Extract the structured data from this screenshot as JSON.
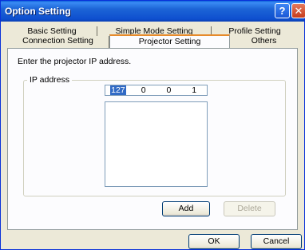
{
  "window": {
    "title": "Option Setting",
    "help_glyph": "?",
    "close_glyph": "✕"
  },
  "tabs": {
    "row1": [
      {
        "label": "Basic Setting"
      },
      {
        "label": "Simple Mode Setting"
      },
      {
        "label": "Profile Setting"
      }
    ],
    "row2": [
      {
        "label": "Connection Setting"
      },
      {
        "label": "Projector Setting",
        "selected": true
      },
      {
        "label": "Others"
      }
    ]
  },
  "panel": {
    "prompt": "Enter the projector IP address.",
    "group_label": "IP address",
    "ip_octets": [
      "127",
      "0",
      "0",
      "1"
    ],
    "ip_list_items": []
  },
  "buttons": {
    "add": "Add",
    "delete": "Delete",
    "ok": "OK",
    "cancel": "Cancel"
  },
  "colors": {
    "titlebar": "#0a5fd8",
    "dialog_bg": "#ece9d8",
    "panel_bg": "#fcfcfe",
    "selected_tab_accent": "#e68b2c",
    "selection": "#316ac5"
  }
}
